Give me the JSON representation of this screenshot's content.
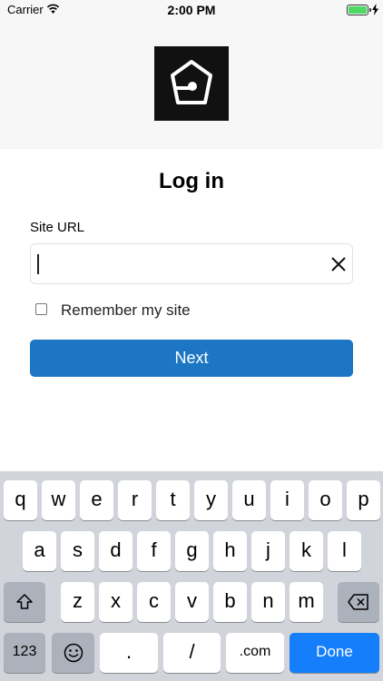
{
  "status_bar": {
    "carrier": "Carrier",
    "time": "2:00 PM",
    "battery_percent": 100
  },
  "login": {
    "title": "Log in",
    "site_url_label": "Site URL",
    "site_url_value": "",
    "remember_label": "Remember my site",
    "remember_checked": false,
    "next_label": "Next"
  },
  "keyboard": {
    "row1": [
      "q",
      "w",
      "e",
      "r",
      "t",
      "y",
      "u",
      "i",
      "o",
      "p"
    ],
    "row2": [
      "a",
      "s",
      "d",
      "f",
      "g",
      "h",
      "j",
      "k",
      "l"
    ],
    "row3": [
      "z",
      "x",
      "c",
      "v",
      "b",
      "n",
      "m"
    ],
    "bottom": {
      "numbers": "123",
      "dot": ".",
      "slash": "/",
      "dotcom": ".com",
      "done": "Done"
    }
  },
  "icons": [
    "wifi-icon",
    "battery-icon",
    "charging-icon",
    "app-logo-icon",
    "clear-icon",
    "shift-icon",
    "backspace-icon",
    "emoji-icon"
  ]
}
